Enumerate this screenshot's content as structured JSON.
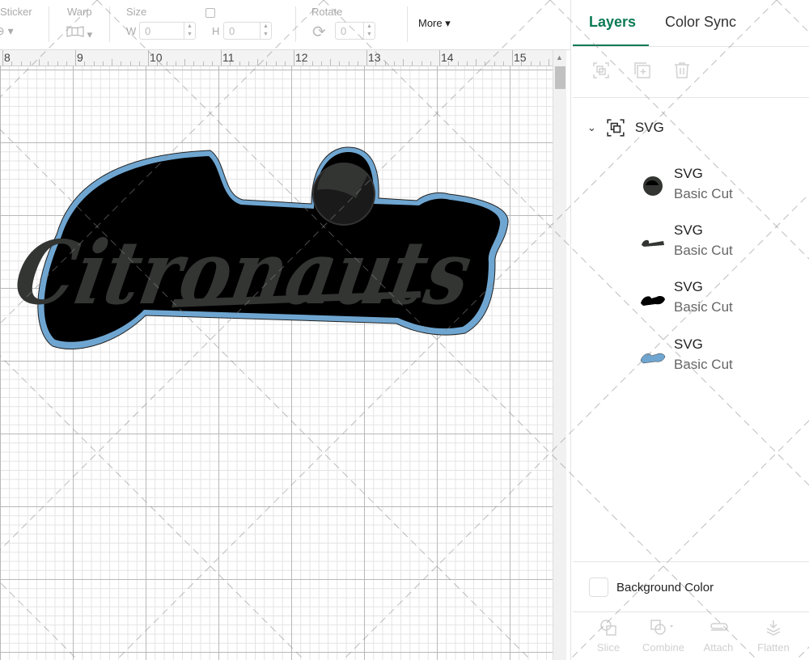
{
  "toolbar": {
    "sticker": "Sticker",
    "warp": "Warp",
    "size": "Size",
    "w_label": "W",
    "w_value": "0",
    "h_label": "H",
    "h_value": "0",
    "rotate": "Rotate",
    "rotate_value": "0",
    "more": "More"
  },
  "ruler": {
    "marks": [
      "8",
      "9",
      "10",
      "11",
      "12",
      "13",
      "14",
      "15"
    ]
  },
  "canvas": {
    "logo_text": "Citronauts",
    "colors": {
      "outline": "#6fa6d1",
      "black": "#000000",
      "gray": "#333533"
    }
  },
  "panel": {
    "tabs": [
      {
        "label": "Layers",
        "active": true
      },
      {
        "label": "Color Sync",
        "active": false
      }
    ],
    "group": {
      "label": "SVG"
    },
    "layers": [
      {
        "name": "SVG",
        "type": "Basic Cut",
        "color": "#333533"
      },
      {
        "name": "SVG",
        "type": "Basic Cut",
        "color": "#333533"
      },
      {
        "name": "SVG",
        "type": "Basic Cut",
        "color": "#000000"
      },
      {
        "name": "SVG",
        "type": "Basic Cut",
        "color": "#6fa6d1"
      }
    ],
    "background_color": "Background Color",
    "bottom": [
      "Slice",
      "Combine",
      "Attach",
      "Flatten"
    ]
  },
  "accent": "#0b7a55"
}
